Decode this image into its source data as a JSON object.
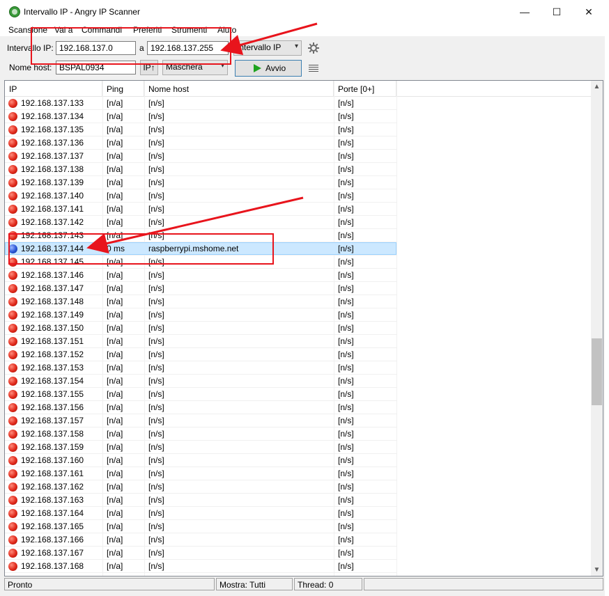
{
  "window": {
    "title": "Intervallo IP - Angry IP Scanner"
  },
  "window_controls": {
    "minimize": "—",
    "maximize": "☐",
    "close": "✕"
  },
  "menu": [
    "Scansione",
    "Vai a",
    "Commandi",
    "Preferiti",
    "Strumenti",
    "Aiuto"
  ],
  "toolbar": {
    "range_label": "Intervallo IP:",
    "ip_from": "192.168.137.0",
    "to_label": "a",
    "ip_to": "192.168.137.255",
    "mode_select": "Intervallo IP",
    "hostname_label": "Nome host:",
    "hostname": "BSPAL0934",
    "ip_button": "IP↑",
    "mask_select": "Maschera",
    "start_button": "Avvio",
    "select_arrow": "▾"
  },
  "table": {
    "columns": [
      "IP",
      "Ping",
      "Nome host",
      "Porte [0+]"
    ],
    "rows": [
      {
        "ip": "192.168.137.133",
        "ping": "[n/a]",
        "host": "[n/s]",
        "ports": "[n/s]",
        "alive": false
      },
      {
        "ip": "192.168.137.134",
        "ping": "[n/a]",
        "host": "[n/s]",
        "ports": "[n/s]",
        "alive": false
      },
      {
        "ip": "192.168.137.135",
        "ping": "[n/a]",
        "host": "[n/s]",
        "ports": "[n/s]",
        "alive": false
      },
      {
        "ip": "192.168.137.136",
        "ping": "[n/a]",
        "host": "[n/s]",
        "ports": "[n/s]",
        "alive": false
      },
      {
        "ip": "192.168.137.137",
        "ping": "[n/a]",
        "host": "[n/s]",
        "ports": "[n/s]",
        "alive": false
      },
      {
        "ip": "192.168.137.138",
        "ping": "[n/a]",
        "host": "[n/s]",
        "ports": "[n/s]",
        "alive": false
      },
      {
        "ip": "192.168.137.139",
        "ping": "[n/a]",
        "host": "[n/s]",
        "ports": "[n/s]",
        "alive": false
      },
      {
        "ip": "192.168.137.140",
        "ping": "[n/a]",
        "host": "[n/s]",
        "ports": "[n/s]",
        "alive": false
      },
      {
        "ip": "192.168.137.141",
        "ping": "[n/a]",
        "host": "[n/s]",
        "ports": "[n/s]",
        "alive": false
      },
      {
        "ip": "192.168.137.142",
        "ping": "[n/a]",
        "host": "[n/s]",
        "ports": "[n/s]",
        "alive": false
      },
      {
        "ip": "192.168.137.143",
        "ping": "[n/a]",
        "host": "[n/s]",
        "ports": "[n/s]",
        "alive": false
      },
      {
        "ip": "192.168.137.144",
        "ping": "0 ms",
        "host": "raspberrypi.mshome.net",
        "ports": "[n/s]",
        "alive": true,
        "selected": true
      },
      {
        "ip": "192.168.137.145",
        "ping": "[n/a]",
        "host": "[n/s]",
        "ports": "[n/s]",
        "alive": false
      },
      {
        "ip": "192.168.137.146",
        "ping": "[n/a]",
        "host": "[n/s]",
        "ports": "[n/s]",
        "alive": false
      },
      {
        "ip": "192.168.137.147",
        "ping": "[n/a]",
        "host": "[n/s]",
        "ports": "[n/s]",
        "alive": false
      },
      {
        "ip": "192.168.137.148",
        "ping": "[n/a]",
        "host": "[n/s]",
        "ports": "[n/s]",
        "alive": false
      },
      {
        "ip": "192.168.137.149",
        "ping": "[n/a]",
        "host": "[n/s]",
        "ports": "[n/s]",
        "alive": false
      },
      {
        "ip": "192.168.137.150",
        "ping": "[n/a]",
        "host": "[n/s]",
        "ports": "[n/s]",
        "alive": false
      },
      {
        "ip": "192.168.137.151",
        "ping": "[n/a]",
        "host": "[n/s]",
        "ports": "[n/s]",
        "alive": false
      },
      {
        "ip": "192.168.137.152",
        "ping": "[n/a]",
        "host": "[n/s]",
        "ports": "[n/s]",
        "alive": false
      },
      {
        "ip": "192.168.137.153",
        "ping": "[n/a]",
        "host": "[n/s]",
        "ports": "[n/s]",
        "alive": false
      },
      {
        "ip": "192.168.137.154",
        "ping": "[n/a]",
        "host": "[n/s]",
        "ports": "[n/s]",
        "alive": false
      },
      {
        "ip": "192.168.137.155",
        "ping": "[n/a]",
        "host": "[n/s]",
        "ports": "[n/s]",
        "alive": false
      },
      {
        "ip": "192.168.137.156",
        "ping": "[n/a]",
        "host": "[n/s]",
        "ports": "[n/s]",
        "alive": false
      },
      {
        "ip": "192.168.137.157",
        "ping": "[n/a]",
        "host": "[n/s]",
        "ports": "[n/s]",
        "alive": false
      },
      {
        "ip": "192.168.137.158",
        "ping": "[n/a]",
        "host": "[n/s]",
        "ports": "[n/s]",
        "alive": false
      },
      {
        "ip": "192.168.137.159",
        "ping": "[n/a]",
        "host": "[n/s]",
        "ports": "[n/s]",
        "alive": false
      },
      {
        "ip": "192.168.137.160",
        "ping": "[n/a]",
        "host": "[n/s]",
        "ports": "[n/s]",
        "alive": false
      },
      {
        "ip": "192.168.137.161",
        "ping": "[n/a]",
        "host": "[n/s]",
        "ports": "[n/s]",
        "alive": false
      },
      {
        "ip": "192.168.137.162",
        "ping": "[n/a]",
        "host": "[n/s]",
        "ports": "[n/s]",
        "alive": false
      },
      {
        "ip": "192.168.137.163",
        "ping": "[n/a]",
        "host": "[n/s]",
        "ports": "[n/s]",
        "alive": false
      },
      {
        "ip": "192.168.137.164",
        "ping": "[n/a]",
        "host": "[n/s]",
        "ports": "[n/s]",
        "alive": false
      },
      {
        "ip": "192.168.137.165",
        "ping": "[n/a]",
        "host": "[n/s]",
        "ports": "[n/s]",
        "alive": false
      },
      {
        "ip": "192.168.137.166",
        "ping": "[n/a]",
        "host": "[n/s]",
        "ports": "[n/s]",
        "alive": false
      },
      {
        "ip": "192.168.137.167",
        "ping": "[n/a]",
        "host": "[n/s]",
        "ports": "[n/s]",
        "alive": false
      },
      {
        "ip": "192.168.137.168",
        "ping": "[n/a]",
        "host": "[n/s]",
        "ports": "[n/s]",
        "alive": false
      }
    ]
  },
  "scrollbar": {
    "up": "▲",
    "down": "▼"
  },
  "status": {
    "state": "Pronto",
    "display": "Mostra: Tutti",
    "threads": "Thread: 0"
  },
  "colors": {
    "annotation": "#e8141c",
    "selection": "#cce8ff",
    "dead_host": "#e0281a",
    "alive_host": "#2a56d6",
    "start_icon": "#1fa31f"
  }
}
